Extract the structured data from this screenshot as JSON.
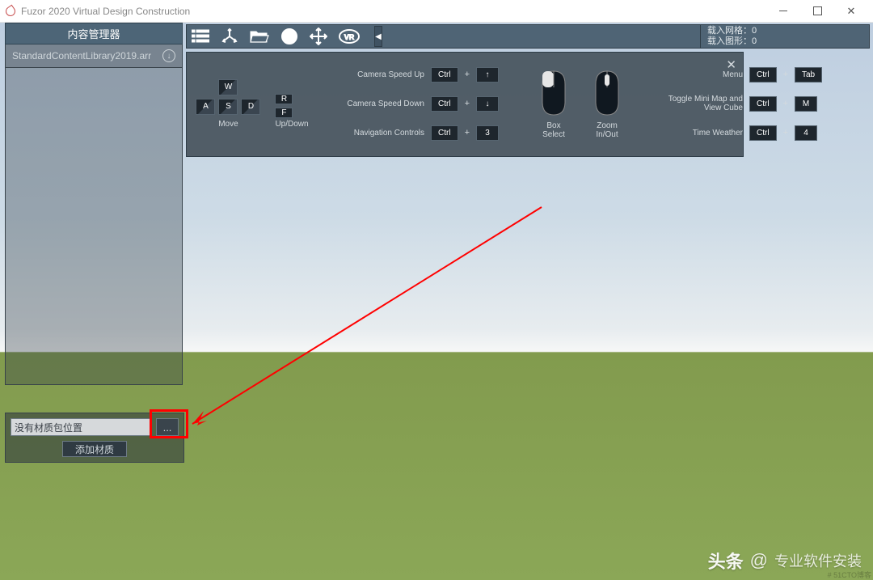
{
  "window": {
    "title": "Fuzor 2020 Virtual Design Construction"
  },
  "sidebar": {
    "title": "内容管理器",
    "library_file": "StandardContentLibrary2019.arr",
    "no_material_path": "没有材质包位置",
    "browse": "...",
    "add_material": "添加材质"
  },
  "hud": {
    "loaded_grid": "载入网格：0",
    "loaded_shapes": "载入图形：0"
  },
  "controls": {
    "move_label": "Move",
    "updown_label": "Up/Down",
    "keys": {
      "w": "W",
      "a": "A",
      "s": "S",
      "d": "D",
      "r": "R",
      "f": "F",
      "ctrl": "Ctrl",
      "three": "3",
      "four": "4",
      "tab": "Tab",
      "m": "M",
      "up": "↑",
      "down": "↓",
      "plus": "+"
    },
    "shortcuts": {
      "speed_up": "Camera Speed Up",
      "speed_down": "Camera Speed Down",
      "nav": "Navigation Controls",
      "menu": "Menu",
      "toggle_minimap": "Toggle Mini Map and View Cube",
      "time_weather": "Time Weather"
    },
    "mouse": {
      "box_select": "Box Select",
      "zoom": "Zoom In/Out"
    }
  },
  "watermark": {
    "head": "头条",
    "at": "@",
    "name": "专业软件安装"
  },
  "corner": "# 51CTO博客"
}
